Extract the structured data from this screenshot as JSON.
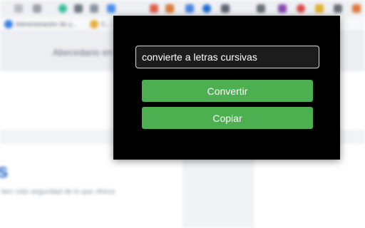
{
  "background": {
    "bookmarks": [
      {
        "label": "Administración de y..."
      },
      {
        "label": "C..."
      }
    ],
    "site_nav_text": "Abecedario en l...",
    "heading_fragment": "s",
    "body_fragment": "ben más seguridad de lo que ofrece"
  },
  "popup": {
    "input_value": "convierte a letras cursivas",
    "convert_label": "Convertir",
    "copy_label": "Copiar",
    "colors": {
      "background": "#000000",
      "button": "#4caf50",
      "button_text": "#ffffff",
      "input_border": "#d8d8d8"
    }
  }
}
